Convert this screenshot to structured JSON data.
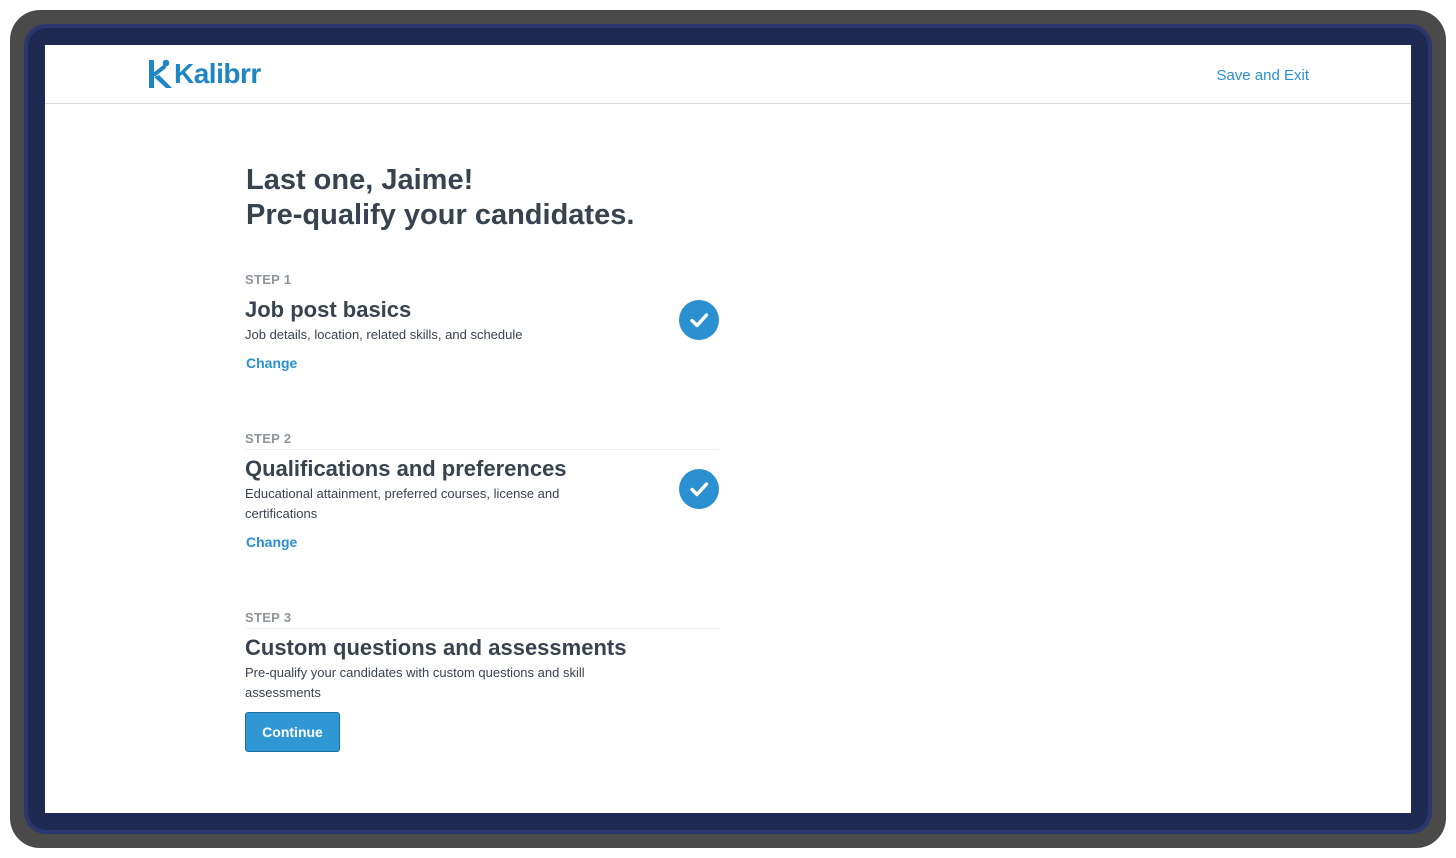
{
  "header": {
    "logo_text": "Kalibrr",
    "save_exit_label": "Save and Exit"
  },
  "headline": {
    "line1": "Last one, Jaime!",
    "line2": "Pre-qualify your candidates."
  },
  "steps": [
    {
      "kicker": "STEP 1",
      "title": "Job post basics",
      "description": "Job details, location, related skills, and schedule",
      "action_label": "Change",
      "completed": true,
      "icon": "checkmark-circle-icon"
    },
    {
      "kicker": "STEP 2",
      "title": "Qualifications and preferences",
      "description": "Educational attainment, preferred courses, license and certifications",
      "action_label": "Change",
      "completed": true,
      "icon": "checkmark-circle-icon"
    },
    {
      "kicker": "STEP 3",
      "title": "Custom questions and assessments",
      "description": "Pre-qualify your candidates with custom questions and skill assessments",
      "action_label": "Continue",
      "completed": false
    }
  ],
  "colors": {
    "brand": "#1f86c6",
    "link": "#2a8fd0",
    "primary_button": "#2f97d3",
    "heading_text": "#39424f",
    "muted_text": "#8e949b"
  }
}
